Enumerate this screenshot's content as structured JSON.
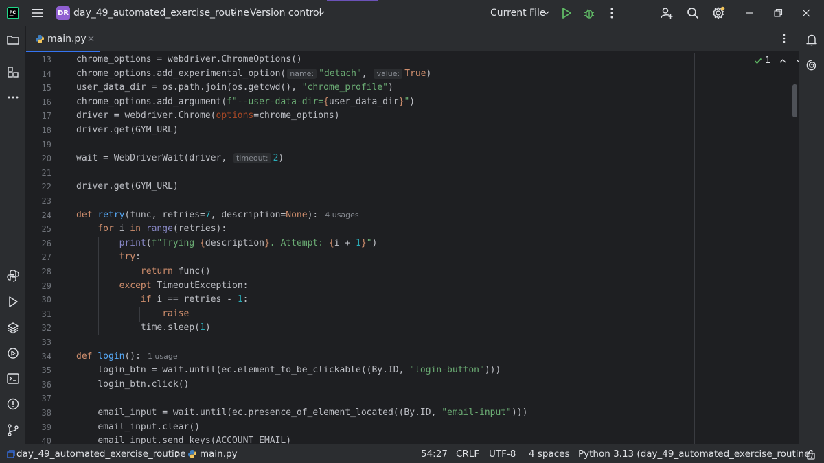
{
  "titlebar": {
    "project_badge": "DR",
    "project_name": "day_49_automated_exercise_routine",
    "vcs_label": "Version control",
    "run_config": "Current File"
  },
  "tabs": [
    {
      "label": "main.py",
      "active": true
    }
  ],
  "editor": {
    "inspection_count": "1",
    "lines": [
      {
        "n": "13"
      },
      {
        "n": "14"
      },
      {
        "n": "15"
      },
      {
        "n": "16"
      },
      {
        "n": "17"
      },
      {
        "n": "18"
      },
      {
        "n": "19"
      },
      {
        "n": "20"
      },
      {
        "n": "21"
      },
      {
        "n": "22"
      },
      {
        "n": "23"
      },
      {
        "n": "24"
      },
      {
        "n": "25"
      },
      {
        "n": "26"
      },
      {
        "n": "27"
      },
      {
        "n": "28"
      },
      {
        "n": "29"
      },
      {
        "n": "30"
      },
      {
        "n": "31"
      },
      {
        "n": "32"
      },
      {
        "n": "33"
      },
      {
        "n": "34"
      },
      {
        "n": "35"
      },
      {
        "n": "36"
      },
      {
        "n": "37"
      },
      {
        "n": "38"
      },
      {
        "n": "39"
      },
      {
        "n": "40"
      }
    ],
    "code": {
      "l13": "chrome_options = webdriver.ChromeOptions()",
      "l14a": "chrome_options.add_experimental_option(",
      "l14_hint_name": "name:",
      "l14_str": "\"detach\"",
      "l14_comma": ",",
      "l14_hint_value": "value:",
      "l14_true": "True",
      "l14_end": ")",
      "l15a": "user_data_dir = os.path.join(os.getcwd(), ",
      "l15_str": "\"chrome_profile\"",
      "l15_end": ")",
      "l16a": "chrome_options.add_argument(",
      "l16_str1": "f\"--user-data-dir=",
      "l16_brace_o": "{",
      "l16_var": "user_data_dir",
      "l16_brace_c": "}",
      "l16_str2": "\"",
      "l16_end": ")",
      "l17a": "driver = webdriver.Chrome(",
      "l17_kw": "options",
      "l17_end": "=chrome_options)",
      "l18": "driver.get(GYM_URL)",
      "l20a": "wait = WebDriverWait(driver,",
      "l20_hint": "timeout:",
      "l20_num": "2",
      "l20_end": ")",
      "l22": "driver.get(GYM_URL)",
      "l24_def": "def",
      "l24_fn": "retry",
      "l24_a": "(func, retries=",
      "l24_n": "7",
      "l24_b": ", description=",
      "l24_none": "None",
      "l24_c": "):",
      "l24_usage": "4 usages",
      "l25_for": "for",
      "l25_i": " i ",
      "l25_in": "in",
      "l25_range": "range",
      "l25_end": "(retries):",
      "l26_print": "print",
      "l26_a": "(",
      "l26_s1": "f\"Trying ",
      "l26_bo1": "{",
      "l26_v1": "description",
      "l26_bc1": "}",
      "l26_s2": ". Attempt: ",
      "l26_bo2": "{",
      "l26_v2": "i + ",
      "l26_n": "1",
      "l26_bc2": "}",
      "l26_s3": "\"",
      "l26_end": ")",
      "l27": "try",
      "l27_colon": ":",
      "l28_ret": "return",
      "l28_rest": " func()",
      "l29_exc": "except",
      "l29_rest": " TimeoutException:",
      "l30_if": "if",
      "l30_a": " i == retries - ",
      "l30_n": "1",
      "l30_c": ":",
      "l31": "raise",
      "l32a": "time.sleep(",
      "l32_n": "1",
      "l32_end": ")",
      "l34_def": "def",
      "l34_fn": "login",
      "l34_rest": "():",
      "l34_usage": "1 usage",
      "l35a": "login_btn = wait.until(ec.element_to_be_clickable((By.ID, ",
      "l35_str": "\"login-button\"",
      "l35_end": ")))",
      "l36": "login_btn.click()",
      "l38a": "email_input = wait.until(ec.presence_of_element_located((By.ID, ",
      "l38_str": "\"email-input\"",
      "l38_end": ")))",
      "l39": "email_input.clear()",
      "l40": "email_input.send_keys(ACCOUNT_EMAIL)"
    }
  },
  "statusbar": {
    "breadcrumb_project": "day_49_automated_exercise_routine",
    "breadcrumb_file": "main.py",
    "position": "54:27",
    "line_sep": "CRLF",
    "encoding": "UTF-8",
    "indent": "4 spaces",
    "interpreter": "Python 3.13 (day_49_automated_exercise_routine)"
  },
  "colors": {
    "accent": "#3574f0",
    "keyword": "#cf8e6d",
    "string": "#6aab73",
    "number": "#2aacb8",
    "function": "#56a8f5",
    "run_green": "#5fb865",
    "notification_dot": "#f2c55c"
  }
}
